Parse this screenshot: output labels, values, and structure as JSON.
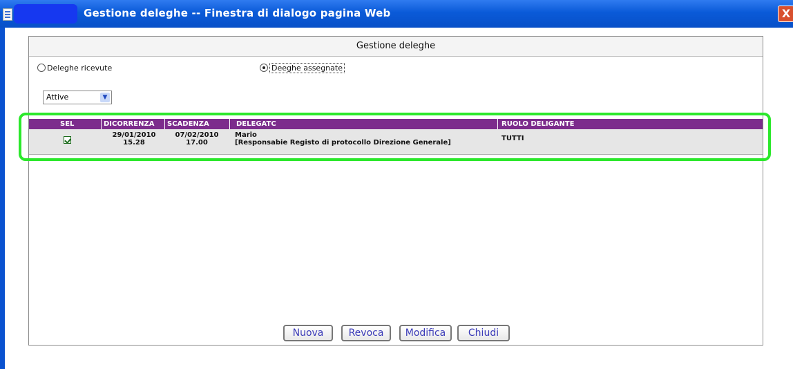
{
  "window": {
    "title": "Gestione deleghe -- Finestra di dialogo pagina Web",
    "close_glyph": "X"
  },
  "dialog": {
    "header": "Gestione deleghe",
    "radio_received_label": "Deleghe ricevute",
    "radio_assigned_label": "Deeghe assegnate",
    "selected_radio": "assigned",
    "filter_value": "Attive"
  },
  "table": {
    "columns": [
      "SEL",
      "DICORRENZA",
      "SCADENZA",
      "DELEGATC",
      "RUOLO DELIGANTE"
    ],
    "rows": [
      {
        "selected": true,
        "decorrenza_date": "29/01/2010",
        "decorrenza_time": "15.28",
        "scadenza_date": "07/02/2010",
        "scadenza_time": "17.00",
        "delegato_name": "Mario",
        "delegato_role": "[Responsabie Registo di protocollo Direzione Generale]",
        "ruolo": "TUTTI"
      }
    ]
  },
  "buttons": {
    "new": "Nuova",
    "revoke": "Revoca",
    "edit": "Modifica",
    "close": "Chiudi"
  },
  "colors": {
    "titlebar": "#0a5ad8",
    "table_header": "#7c2c8c",
    "highlight": "#2ce82c",
    "button_text": "#3a3ab8"
  }
}
